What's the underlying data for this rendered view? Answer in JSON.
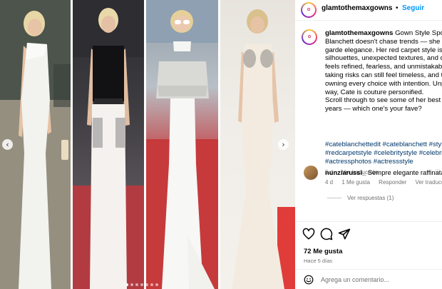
{
  "post": {
    "username": "glamtothemaxgowns",
    "follow_separator": "•",
    "follow_label": "Seguir",
    "avatar_glyph": "✿",
    "caption_username": "glamtothemaxgowns",
    "caption_lines": [
      " Gown Style Spotlig",
      "Blanchett doesn't chase trends — she lead",
      "garde elegance. Her red carpet style is a r",
      "silhouettes, unexpected textures, and dran",
      "feels refined, fearless, and unmistakably h",
      "taking risks can still feel timeless, and that",
      "owning every choice with intention. Unpre",
      "way, Cate is couture personified.",
      "Scroll through to see some of her best rec",
      "years — which one's your fave?"
    ],
    "hashtag_lines": [
      "#cateblanchettedit #cateblanchett #stylei",
      "#redcarpetstyle #celebritystyle #celebrityf",
      "#actressphotos #actressstyle"
    ],
    "post_age": "5 d",
    "see_translation": "Ver traducción",
    "likes": "72 Me gusta",
    "posted_ago": "Hace 5 días",
    "comment_placeholder": "Agrega un comentario..."
  },
  "comment": {
    "username": "nunziarussi_",
    "text": " Sempre elegante raffinata",
    "age": "4 d",
    "likes": "1 Me gusta",
    "reply": "Responder",
    "translate": "Ver traducción",
    "replies": "Ver respuestas (1)"
  },
  "carousel": {
    "prev_arrow": "‹",
    "next_arrow": "›",
    "total_slides": 7,
    "active_slide": 1
  },
  "icons": {
    "avatar": "gown-logo-icon",
    "heart": "heart-outline-icon",
    "comment": "comment-bubble-icon",
    "share": "paper-plane-icon",
    "emoji": "smiley-icon",
    "comment_heart": "small-heart-icon"
  },
  "colors": {
    "link_blue": "#0095f6",
    "hashtag_blue": "#00376b",
    "muted_grey": "#737373",
    "red_carpet": "#c63a3c"
  }
}
